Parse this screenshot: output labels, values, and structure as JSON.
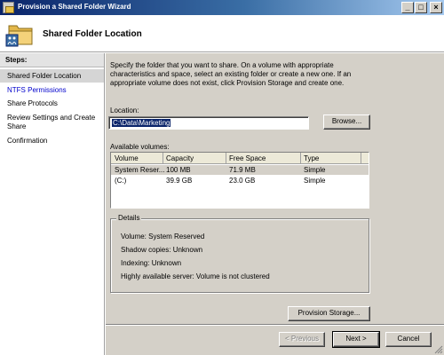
{
  "window": {
    "title": "Provision a Shared Folder Wizard",
    "controls": {
      "minimize": "_",
      "maximize": "□",
      "close": "×"
    }
  },
  "header": {
    "title": "Shared Folder Location",
    "icon": "shared-folder-icon"
  },
  "steps": {
    "heading": "Steps:",
    "items": [
      {
        "label": "Shared Folder Location",
        "state": "current"
      },
      {
        "label": "NTFS Permissions",
        "state": "link"
      },
      {
        "label": "Share Protocols",
        "state": "normal"
      },
      {
        "label": "Review Settings and Create Share",
        "state": "normal"
      },
      {
        "label": "Confirmation",
        "state": "normal"
      }
    ]
  },
  "main": {
    "description": "Specify the folder that you want to share. On a volume with appropriate characteristics and space, select an existing folder or create a new one. If an appropriate volume does not exist, click Provision Storage and create one.",
    "location_label": "Location:",
    "location_value": "C:\\Data\\Marketing",
    "browse_label": "Browse...",
    "volumes_label": "Available volumes:",
    "volumes": {
      "columns": [
        "Volume",
        "Capacity",
        "Free Space",
        "Type"
      ],
      "rows": [
        [
          "System Reser...",
          "100 MB",
          "71.9 MB",
          "Simple"
        ],
        [
          "(C:)",
          "39.9 GB",
          "23.0 GB",
          "Simple"
        ]
      ]
    },
    "details": {
      "legend": "Details",
      "lines": [
        "Volume:   System Reserved",
        "Shadow copies:   Unknown",
        "Indexing:   Unknown",
        "Highly available server:   Volume is not clustered"
      ]
    },
    "provision_label": "Provision Storage..."
  },
  "buttons": {
    "previous": "< Previous",
    "next": "Next >",
    "cancel": "Cancel"
  },
  "colors": {
    "titlebar_start": "#0a246a",
    "titlebar_end": "#a6caf0",
    "link": "#0000cc",
    "selection": "#0a246a"
  }
}
